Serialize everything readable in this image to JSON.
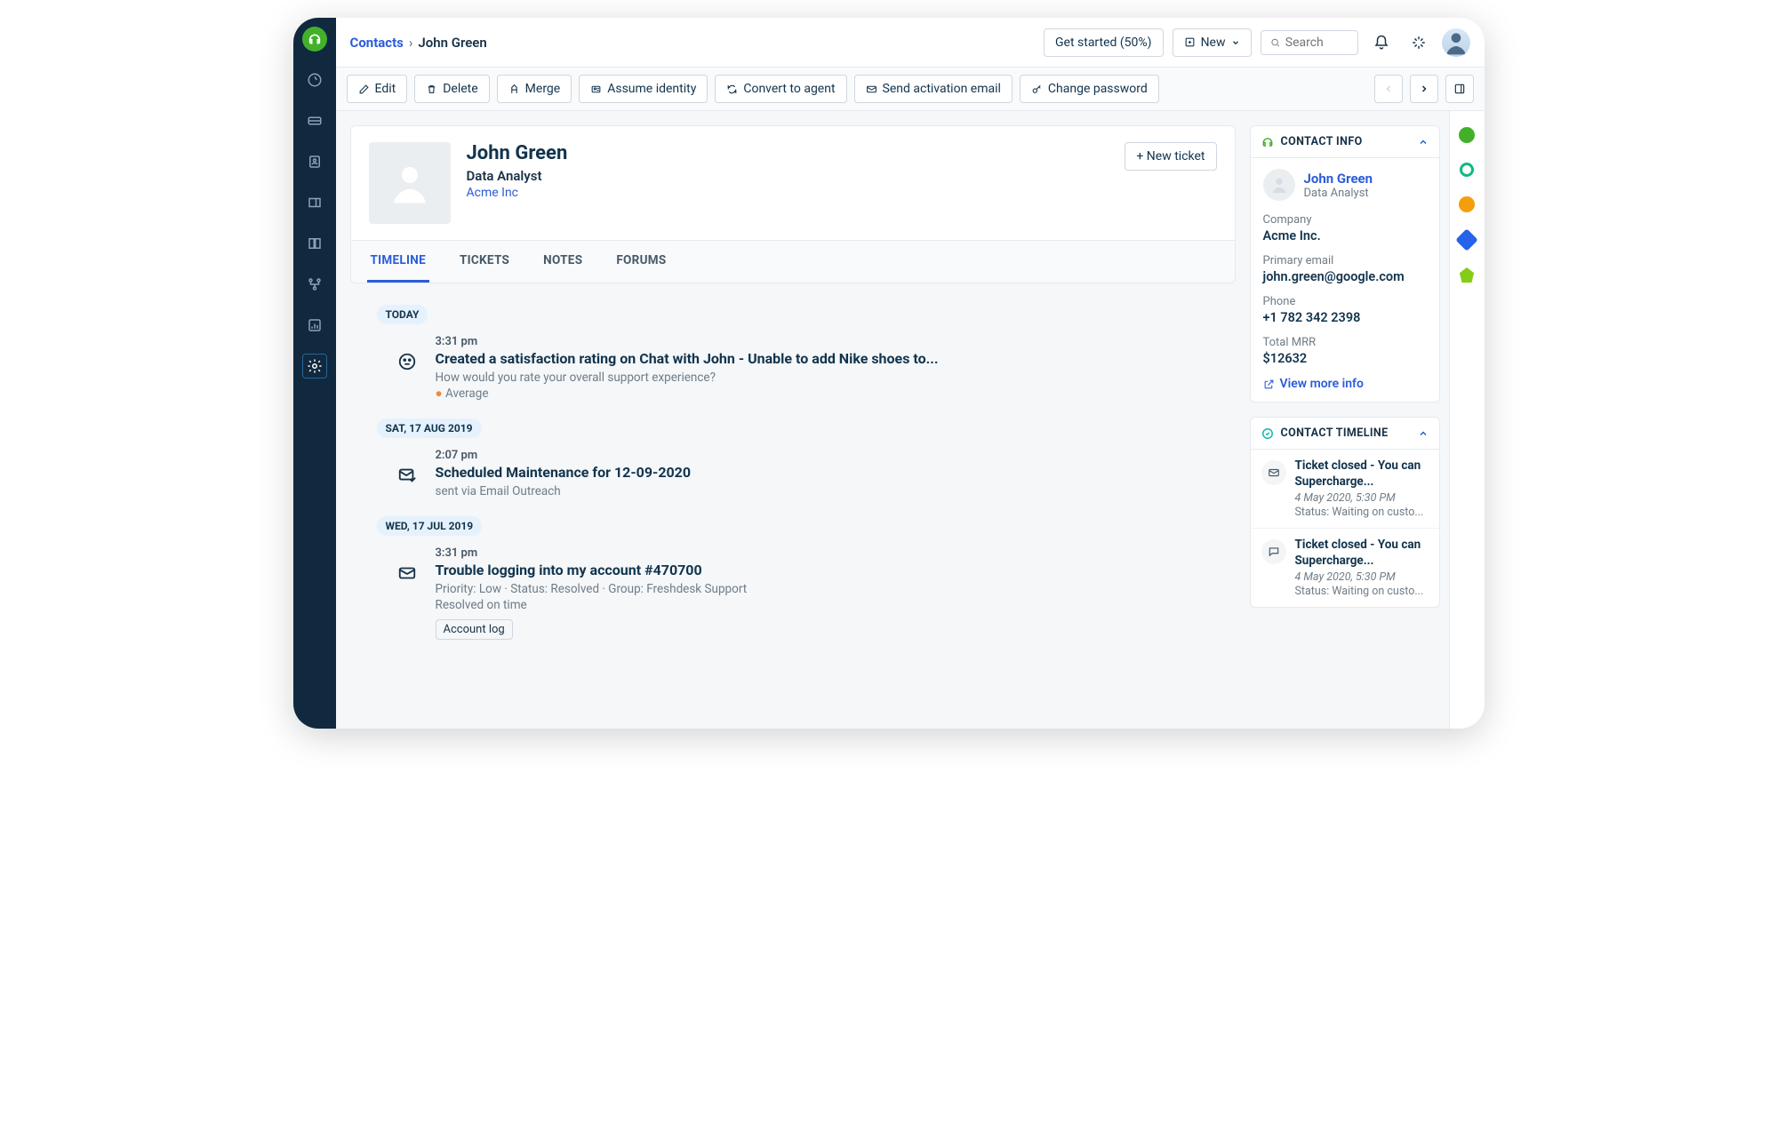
{
  "breadcrumb": {
    "root": "Contacts",
    "current": "John Green"
  },
  "header": {
    "get_started": "Get started (50%)",
    "new_label": "New",
    "search_placeholder": "Search"
  },
  "actions": {
    "edit": "Edit",
    "delete": "Delete",
    "merge": "Merge",
    "assume": "Assume identity",
    "convert": "Convert to agent",
    "send_activation": "Send activation email",
    "change_password": "Change password"
  },
  "profile": {
    "name": "John Green",
    "role": "Data Analyst",
    "company": "Acme Inc",
    "new_ticket": "+ New ticket"
  },
  "tabs": [
    "TIMELINE",
    "TICKETS",
    "NOTES",
    "FORUMS"
  ],
  "timeline": {
    "today_label": "TODAY",
    "groups": [
      {
        "date": "TODAY",
        "items": [
          {
            "time": "3:31 pm",
            "icon": "face",
            "title": "Created a satisfaction rating on Chat with John - Unable to add Nike shoes to...",
            "desc": "How would you rate your overall support experience?",
            "rating": "Average"
          }
        ]
      },
      {
        "date": "SAT, 17 AUG 2019",
        "items": [
          {
            "time": "2:07 pm",
            "icon": "mail-check",
            "title": "Scheduled Maintenance for 12-09-2020",
            "desc": "sent via Email Outreach"
          }
        ]
      },
      {
        "date": "WED, 17 JUL 2019",
        "items": [
          {
            "time": "3:31 pm",
            "icon": "mail",
            "title": "Trouble logging into my account #470700",
            "meta": "Priority: Low  ·  Status: Resolved  ·  Group: Freshdesk Support",
            "meta2": "Resolved on time",
            "badge": "Account log"
          }
        ]
      }
    ]
  },
  "contact_info": {
    "heading": "CONTACT INFO",
    "name": "John Green",
    "role": "Data Analyst",
    "company_label": "Company",
    "company": "Acme Inc.",
    "email_label": "Primary email",
    "email": "john.green@google.com",
    "phone_label": "Phone",
    "phone": "+1 782 342 2398",
    "mrr_label": "Total MRR",
    "mrr": "$12632",
    "view_more": "View more info"
  },
  "contact_timeline": {
    "heading": "CONTACT TIMELINE",
    "items": [
      {
        "icon": "mail",
        "title": "Ticket closed - You can Supercharge...",
        "ts": "4 May 2020, 5:30 PM",
        "status": "Status: Waiting on custo..."
      },
      {
        "icon": "chat",
        "title": "Ticket closed - You can Supercharge...",
        "ts": "4 May 2020, 5:30 PM",
        "status": "Status: Waiting on custo..."
      }
    ]
  }
}
